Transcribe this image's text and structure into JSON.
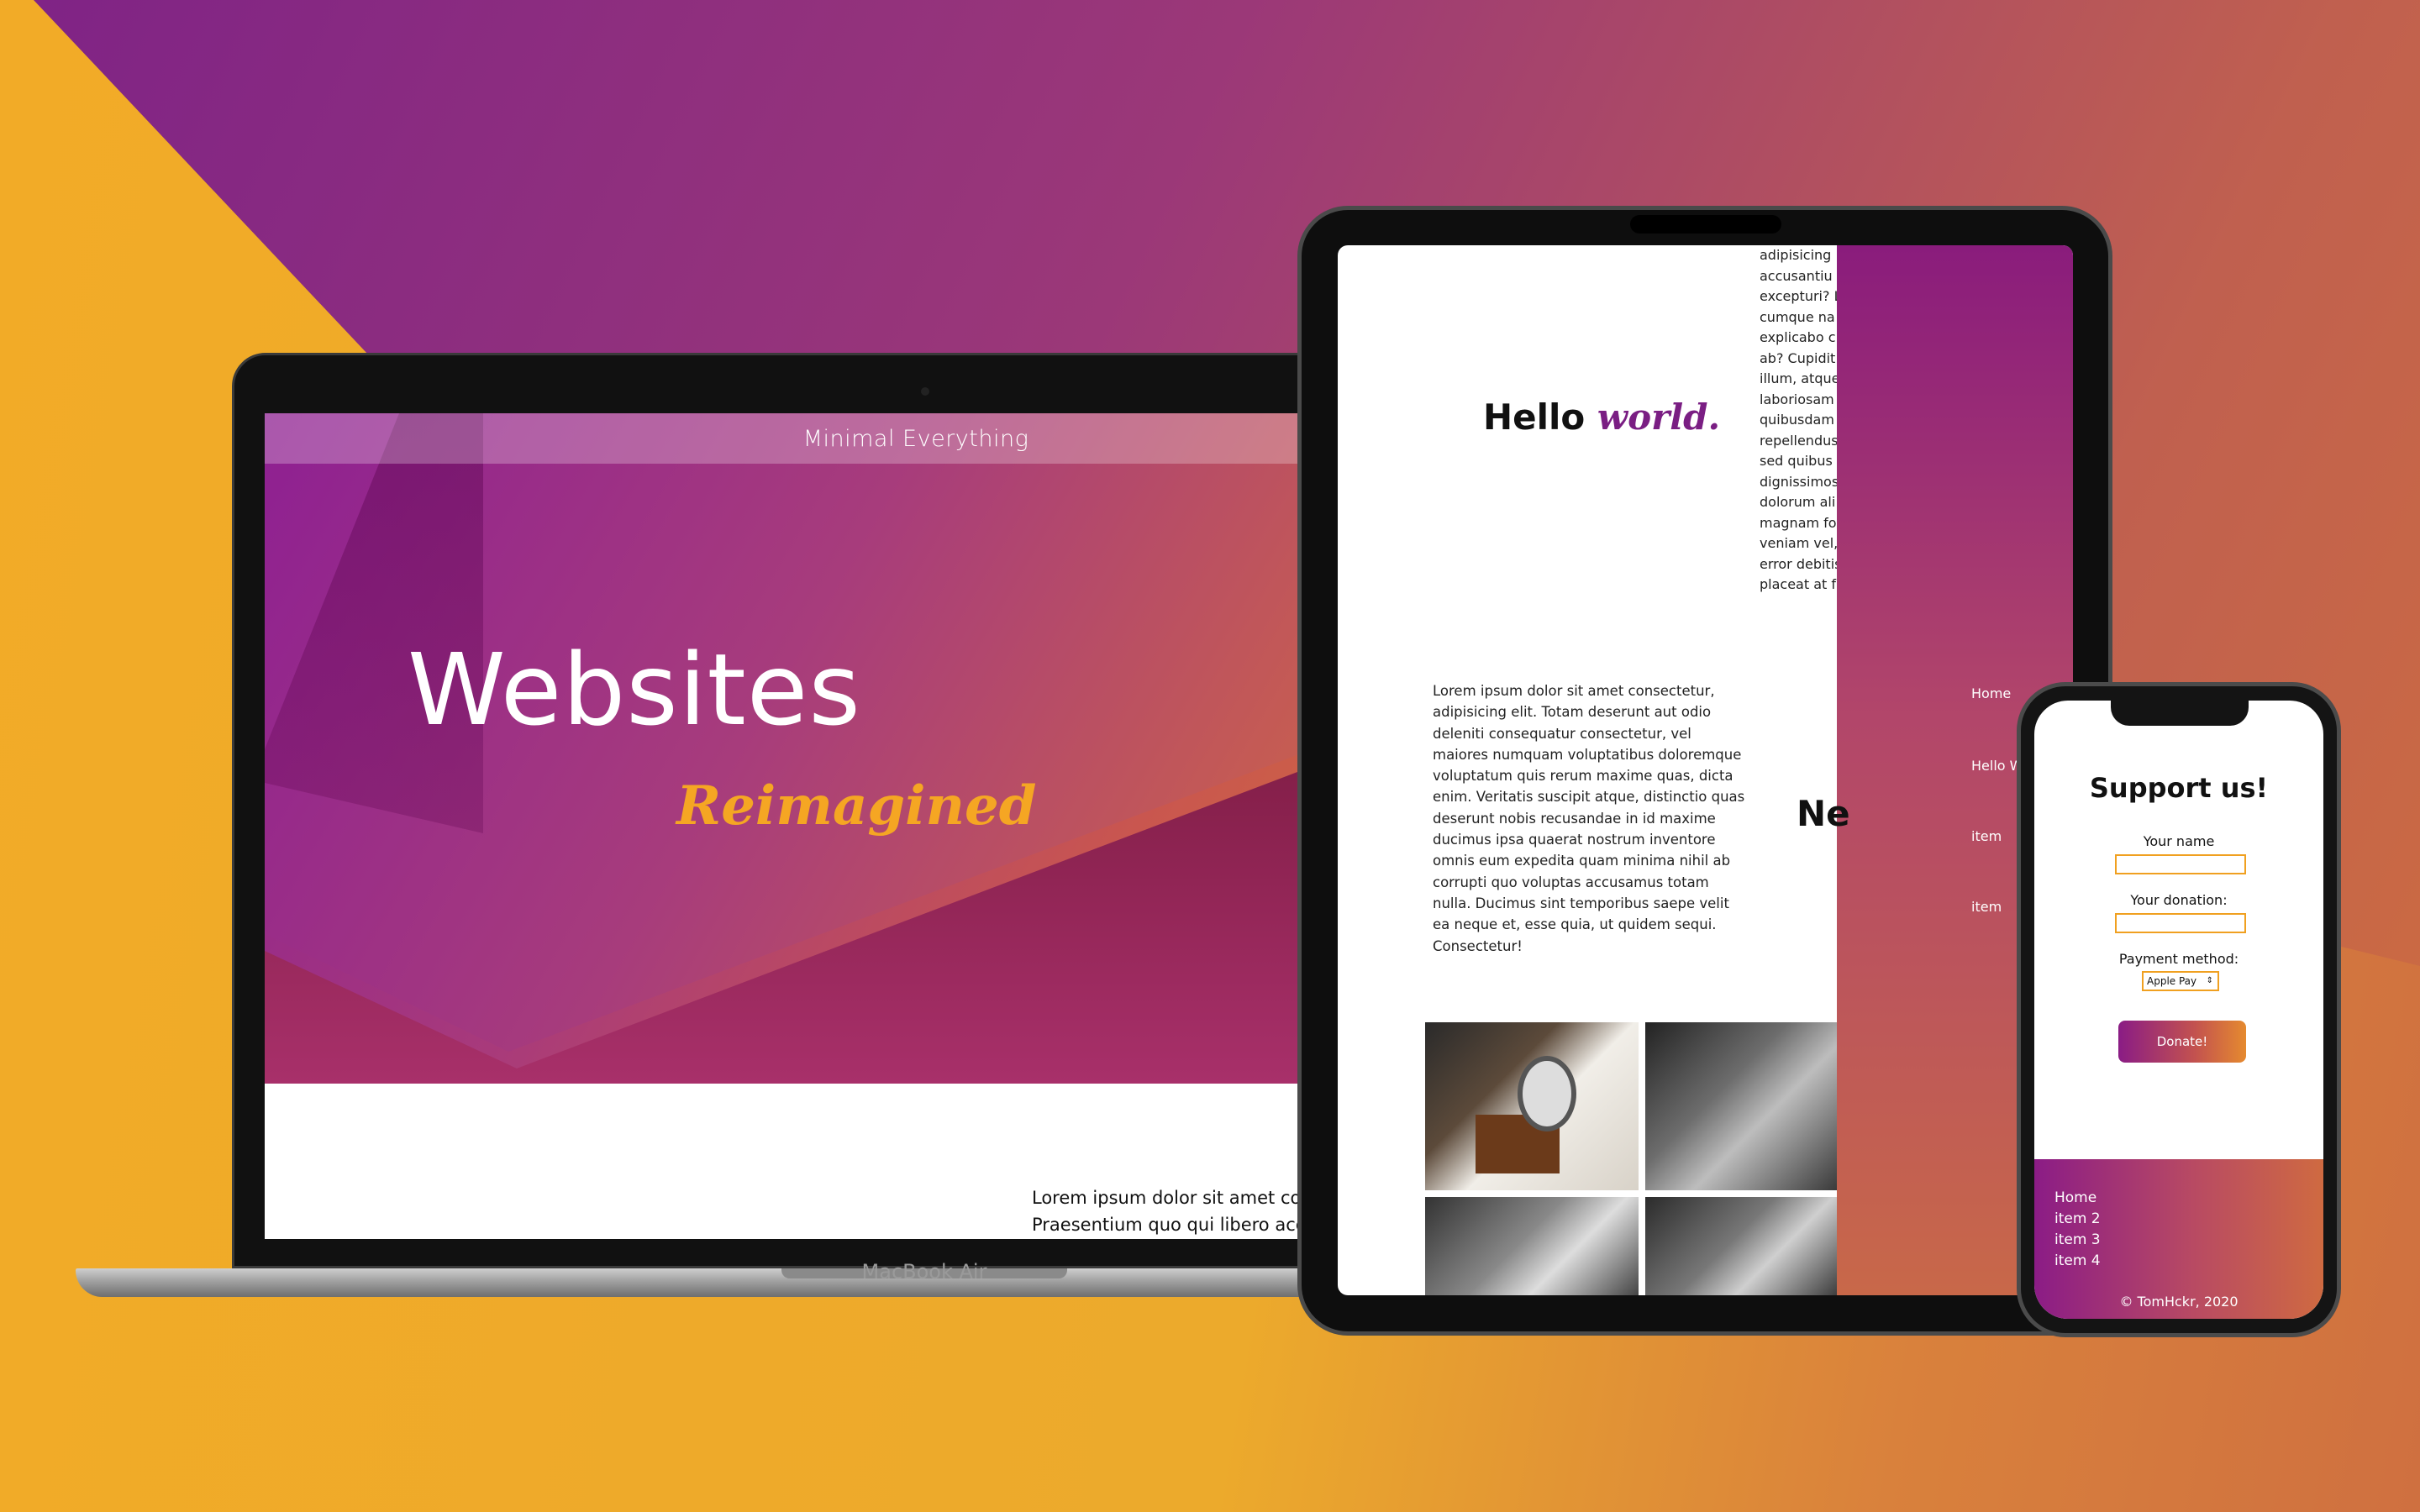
{
  "laptop": {
    "nav_title": "Minimal Everything",
    "hero_title": "Websites",
    "hero_subtitle": "Reimagined",
    "lorem_line1": "Lorem ipsum dolor sit amet con",
    "lorem_line2": "Praesentium quo qui libero acc",
    "device_label": "MacBook Air"
  },
  "tablet": {
    "hello": "Hello",
    "world": "world.",
    "column_lines": [
      "adipisicing",
      "accusantiu",
      "excepturi? L",
      "cumque na",
      "explicabo c",
      "ab? Cupidit",
      "illum, atque",
      "laboriosam",
      "quibusdam",
      "repellendus",
      "sed quibus",
      "dignissimos",
      "dolorum ali",
      "magnam fo",
      "veniam vel,",
      "error debitis",
      "placeat at f"
    ],
    "paragraph": "Lorem ipsum dolor sit amet consectetur, adipisicing elit. Totam deserunt aut odio deleniti consequatur consectetur, vel maiores numquam voluptatibus doloremque voluptatum quis rerum maxime quas, dicta enim. Veritatis suscipit atque, distinctio quas deserunt nobis recusandae in id maxime ducimus ipsa quaerat nostrum inventore omnis eum expedita quam minima nihil ab corrupti quo voluptas accusamus totam nulla. Ducimus sint temporibus saepe velit ea neque et, esse quia, ut quidem sequi. Consectetur!",
    "partial_heading": "Ne",
    "nav": [
      "Home",
      "Hello W",
      "item",
      "item"
    ]
  },
  "phone": {
    "title": "Support us!",
    "name_label": "Your name",
    "donation_label": "Your donation:",
    "payment_label": "Payment method:",
    "payment_selected": "Apple Pay",
    "donate_button": "Donate!",
    "footer_items": [
      "Home",
      "item 2",
      "item 3",
      "item 4"
    ],
    "copyright": "© TomHckr, 2020"
  },
  "colors": {
    "purple": "#8a1c85",
    "orange": "#f5a623",
    "coral": "#cf6e3e"
  }
}
